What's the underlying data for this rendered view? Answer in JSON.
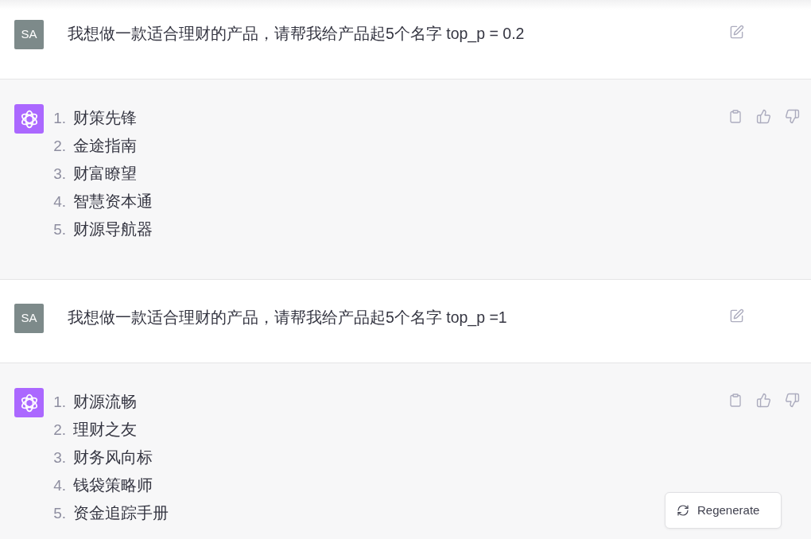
{
  "messages": [
    {
      "kind": "user",
      "avatar": "SA",
      "text": "我想做一款适合理财的产品，请帮我给产品起5个名字 top_p = 0.2"
    },
    {
      "kind": "assistant",
      "items": [
        {
          "number": "1.",
          "text": "财策先锋"
        },
        {
          "number": "2.",
          "text": "金途指南"
        },
        {
          "number": "3.",
          "text": "财富瞭望"
        },
        {
          "number": "4.",
          "text": "智慧资本通"
        },
        {
          "number": "5.",
          "text": "财源导航器"
        }
      ]
    },
    {
      "kind": "user",
      "avatar": "SA",
      "text": "我想做一款适合理财的产品，请帮我给产品起5个名字 top_p =1"
    },
    {
      "kind": "assistant",
      "items": [
        {
          "number": "1.",
          "text": "财源流畅"
        },
        {
          "number": "2.",
          "text": "理财之友"
        },
        {
          "number": "3.",
          "text": "财务风向标"
        },
        {
          "number": "4.",
          "text": "钱袋策略师"
        },
        {
          "number": "5.",
          "text": "资金追踪手册"
        }
      ]
    }
  ],
  "regenerate_button": {
    "label": "Regenerate"
  }
}
